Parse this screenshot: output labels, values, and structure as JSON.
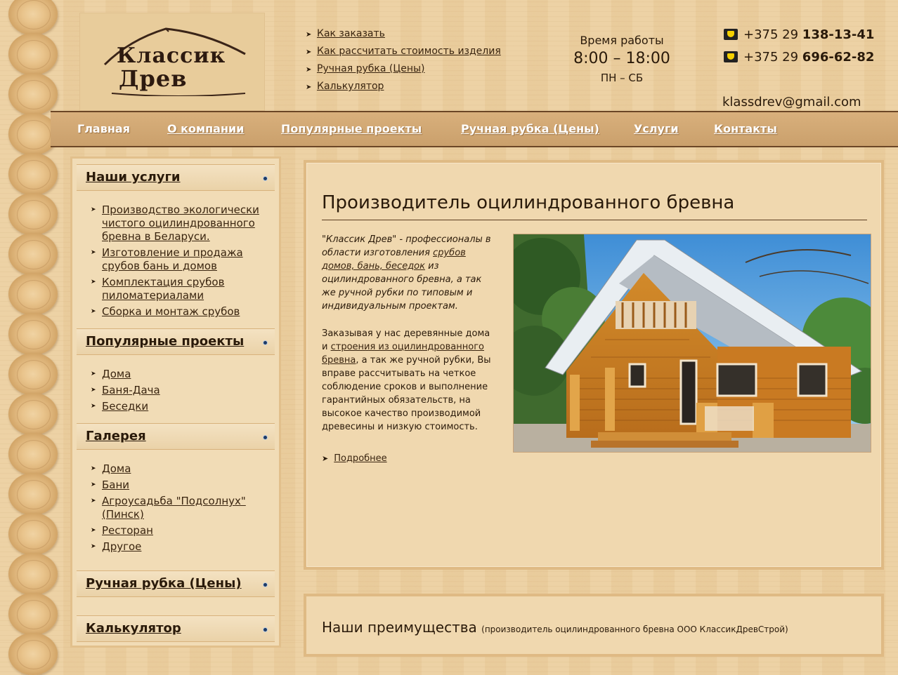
{
  "logo": {
    "line1": "Классик",
    "line2": "Древ"
  },
  "top_links": [
    "Как заказать",
    "Как рассчитать стоимость изделия",
    "Ручная рубка (Цены)",
    "Калькулятор"
  ],
  "hours": {
    "label": "Время работы",
    "time": "8:00 – 18:00",
    "days": "ПН – СБ"
  },
  "phones": [
    {
      "prefix": "+375 29 ",
      "number": "138-13-41"
    },
    {
      "prefix": "+375 29 ",
      "number": "696-62-82"
    }
  ],
  "email": "klassdrev@gmail.com",
  "nav": [
    "Главная",
    "О компании",
    "Популярные проекты",
    "Ручная рубка (Цены)",
    "Услуги",
    "Контакты"
  ],
  "sidebar": {
    "sections": [
      {
        "title": "Наши услуги",
        "items": [
          "Производство экологически чистого оцилиндрованного бревна в Беларуси.",
          "Изготовление и продажа срубов бань и домов",
          "Комплектация срубов пиломатериалами",
          "Сборка и монтаж срубов"
        ]
      },
      {
        "title": "Популярные проекты",
        "items": [
          "Дома",
          "Баня-Дача",
          "Беседки"
        ]
      },
      {
        "title": "Галерея",
        "items": [
          "Дома",
          "Бани",
          "Агроусадьба \"Подсолнух\" (Пинск)",
          "Ресторан",
          "Другое"
        ]
      },
      {
        "title": "Ручная рубка (Цены)",
        "items": []
      },
      {
        "title": "Калькулятор",
        "items": []
      }
    ]
  },
  "main": {
    "title": "Производитель оцилиндрованного бревна",
    "intro_a": "\"Классик Древ\" - профессионалы в области изготовления ",
    "intro_link": "срубов домов, бань, беседок",
    "intro_b": " из оцилиндрованного бревна, а так же ручной рубки по типовым и индивидуальным проектам.",
    "p2_a": "Заказывая у нас деревянные дома и ",
    "p2_link": "строения из оцилиндрованного бревна",
    "p2_b": ", а так же ручной рубки, Вы вправе рассчитывать на четкое соблюдение сроков и выполнение гарантийных обязательств, на высокое качество производимой древесины и низкую стоимость.",
    "more": "Подробнее"
  },
  "advantages": {
    "title": "Наши преимущества",
    "subtitle": "(производитель оцилиндрованного бревна ООО КлассикДревСтрой)"
  }
}
